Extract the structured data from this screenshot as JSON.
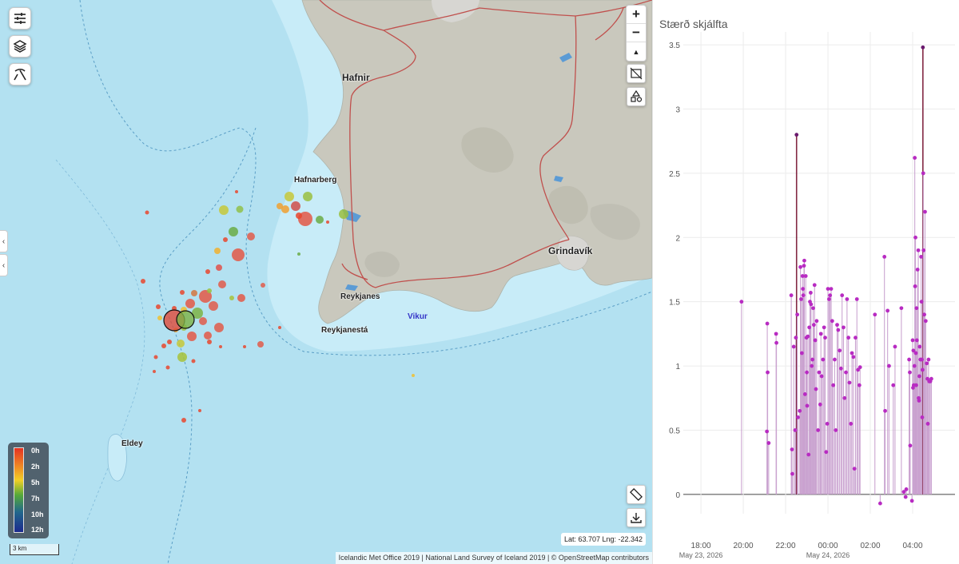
{
  "map": {
    "places": [
      {
        "name": "Hafnir",
        "kind": "big"
      },
      {
        "name": "Hafnarberg",
        "kind": "small"
      },
      {
        "name": "Grindavík",
        "kind": "big"
      },
      {
        "name": "Reykjanes",
        "kind": "small"
      },
      {
        "name": "Reykjanestá",
        "kind": "small"
      },
      {
        "name": "Vikur",
        "kind": "water"
      },
      {
        "name": "Eldey",
        "kind": "small"
      }
    ],
    "legend": {
      "labels": [
        "0h",
        "2h",
        "5h",
        "7h",
        "10h",
        "12h"
      ]
    },
    "scale_label": "3 km",
    "coords": "Lat: 63.707 Lng: -22.342",
    "attribution": "Icelandic Met Office 2019 | National Land Survey of Iceland 2019 | © OpenStreetMap contributors",
    "controls": {
      "zoom_in": "+",
      "zoom_out": "−",
      "reset_north": "▲",
      "left_buttons": [
        "sliders-icon",
        "layers-icon",
        "pickaxe-icon"
      ],
      "right_buttons": [
        "hide-labels-icon",
        "shapes-icon"
      ],
      "bottom_buttons": [
        "ruler-icon",
        "download-icon"
      ]
    },
    "colors": {
      "sea": "#b3e1f1",
      "shelf": "#c9ecf8",
      "land": "#c9c8bd",
      "road": "#c0504d",
      "lake": "#5b9bd5"
    }
  },
  "chart_data": {
    "type": "scatter",
    "title": "Stærð skjálfta",
    "xlabel": "",
    "ylabel": "",
    "ylim": [
      -0.15,
      3.6
    ],
    "yticks": [
      0,
      0.5,
      1,
      1.5,
      2,
      2.5,
      3,
      3.5
    ],
    "xlim": [
      "2026-05-23T17:10",
      "2026-05-24T06:00"
    ],
    "xticks": [
      {
        "t": "2026-05-23T18:00",
        "label": "18:00",
        "sub": "May 23, 2026"
      },
      {
        "t": "2026-05-23T20:00",
        "label": "20:00",
        "sub": ""
      },
      {
        "t": "2026-05-23T22:00",
        "label": "22:00",
        "sub": ""
      },
      {
        "t": "2026-05-24T00:00",
        "label": "00:00",
        "sub": "May 24, 2026"
      },
      {
        "t": "2026-05-24T02:00",
        "label": "02:00",
        "sub": ""
      },
      {
        "t": "2026-05-24T04:00",
        "label": "04:00",
        "sub": ""
      }
    ],
    "colors": {
      "stem": "#c9a1cf",
      "point": "#b82bc2",
      "highlight": "#7d1e3a"
    },
    "series": [
      {
        "points": [
          {
            "t": "2026-05-23T19:55",
            "v": 1.5
          },
          {
            "t": "2026-05-23T21:07",
            "v": 0.49
          },
          {
            "t": "2026-05-23T21:08",
            "v": 1.33
          },
          {
            "t": "2026-05-23T21:09",
            "v": 0.95
          },
          {
            "t": "2026-05-23T21:12",
            "v": 0.4
          },
          {
            "t": "2026-05-23T21:33",
            "v": 1.25
          },
          {
            "t": "2026-05-23T21:34",
            "v": 1.18
          },
          {
            "t": "2026-05-23T22:16",
            "v": 1.55
          },
          {
            "t": "2026-05-23T22:18",
            "v": 0.35
          },
          {
            "t": "2026-05-23T22:19",
            "v": 0.16
          },
          {
            "t": "2026-05-23T22:23",
            "v": 1.15
          },
          {
            "t": "2026-05-23T22:27",
            "v": 0.5
          },
          {
            "t": "2026-05-23T22:29",
            "v": 1.22
          },
          {
            "t": "2026-05-23T22:31",
            "v": 2.8
          },
          {
            "t": "2026-05-23T22:33",
            "v": 1.4
          },
          {
            "t": "2026-05-23T22:35",
            "v": 0.6
          },
          {
            "t": "2026-05-23T22:40",
            "v": 0.65
          },
          {
            "t": "2026-05-23T22:42",
            "v": 1.77
          },
          {
            "t": "2026-05-23T22:44",
            "v": 1.52
          },
          {
            "t": "2026-05-23T22:46",
            "v": 1.1
          },
          {
            "t": "2026-05-23T22:48",
            "v": 1.7
          },
          {
            "t": "2026-05-23T22:49",
            "v": 1.6
          },
          {
            "t": "2026-05-23T22:50",
            "v": 1.55
          },
          {
            "t": "2026-05-23T22:52",
            "v": 1.78
          },
          {
            "t": "2026-05-23T22:53",
            "v": 1.82
          },
          {
            "t": "2026-05-23T22:55",
            "v": 0.78
          },
          {
            "t": "2026-05-23T22:57",
            "v": 1.7
          },
          {
            "t": "2026-05-23T22:59",
            "v": 1.22
          },
          {
            "t": "2026-05-23T23:00",
            "v": 0.95
          },
          {
            "t": "2026-05-23T23:01",
            "v": 0.69
          },
          {
            "t": "2026-05-23T23:03",
            "v": 1.23
          },
          {
            "t": "2026-05-23T23:05",
            "v": 0.31
          },
          {
            "t": "2026-05-23T23:07",
            "v": 1.3
          },
          {
            "t": "2026-05-23T23:09",
            "v": 1.5
          },
          {
            "t": "2026-05-23T23:11",
            "v": 1.57
          },
          {
            "t": "2026-05-23T23:12",
            "v": 1.48
          },
          {
            "t": "2026-05-23T23:14",
            "v": 1.0
          },
          {
            "t": "2026-05-23T23:16",
            "v": 1.05
          },
          {
            "t": "2026-05-23T23:18",
            "v": 1.45
          },
          {
            "t": "2026-05-23T23:20",
            "v": 1.32
          },
          {
            "t": "2026-05-23T23:22",
            "v": 1.63
          },
          {
            "t": "2026-05-23T23:24",
            "v": 1.2
          },
          {
            "t": "2026-05-23T23:26",
            "v": 0.82
          },
          {
            "t": "2026-05-23T23:28",
            "v": 1.35
          },
          {
            "t": "2026-05-23T23:32",
            "v": 0.5
          },
          {
            "t": "2026-05-23T23:35",
            "v": 0.95
          },
          {
            "t": "2026-05-23T23:38",
            "v": 0.7
          },
          {
            "t": "2026-05-23T23:40",
            "v": 1.25
          },
          {
            "t": "2026-05-23T23:42",
            "v": 0.92
          },
          {
            "t": "2026-05-23T23:46",
            "v": 1.05
          },
          {
            "t": "2026-05-23T23:49",
            "v": 1.3
          },
          {
            "t": "2026-05-23T23:52",
            "v": 1.22
          },
          {
            "t": "2026-05-23T23:55",
            "v": 0.33
          },
          {
            "t": "2026-05-23T23:58",
            "v": 0.55
          },
          {
            "t": "2026-05-24T00:00",
            "v": 1.6
          },
          {
            "t": "2026-05-24T00:03",
            "v": 1.52
          },
          {
            "t": "2026-05-24T00:06",
            "v": 1.55
          },
          {
            "t": "2026-05-24T00:09",
            "v": 1.6
          },
          {
            "t": "2026-05-24T00:12",
            "v": 1.35
          },
          {
            "t": "2026-05-24T00:15",
            "v": 0.85
          },
          {
            "t": "2026-05-24T00:19",
            "v": 1.05
          },
          {
            "t": "2026-05-24T00:22",
            "v": 0.5
          },
          {
            "t": "2026-05-24T00:26",
            "v": 1.32
          },
          {
            "t": "2026-05-24T00:29",
            "v": 1.28
          },
          {
            "t": "2026-05-24T00:33",
            "v": 1.12
          },
          {
            "t": "2026-05-24T00:37",
            "v": 0.98
          },
          {
            "t": "2026-05-24T00:40",
            "v": 1.55
          },
          {
            "t": "2026-05-24T00:44",
            "v": 1.3
          },
          {
            "t": "2026-05-24T00:47",
            "v": 0.75
          },
          {
            "t": "2026-05-24T00:51",
            "v": 0.95
          },
          {
            "t": "2026-05-24T00:54",
            "v": 1.52
          },
          {
            "t": "2026-05-24T00:58",
            "v": 1.22
          },
          {
            "t": "2026-05-24T01:01",
            "v": 0.87
          },
          {
            "t": "2026-05-24T01:05",
            "v": 0.55
          },
          {
            "t": "2026-05-24T01:08",
            "v": 1.1
          },
          {
            "t": "2026-05-24T01:12",
            "v": 1.07
          },
          {
            "t": "2026-05-24T01:15",
            "v": 0.2
          },
          {
            "t": "2026-05-24T01:18",
            "v": 1.22
          },
          {
            "t": "2026-05-24T01:22",
            "v": 1.52
          },
          {
            "t": "2026-05-24T01:25",
            "v": 0.97
          },
          {
            "t": "2026-05-24T01:29",
            "v": 0.85
          },
          {
            "t": "2026-05-24T01:31",
            "v": 0.99
          },
          {
            "t": "2026-05-24T02:13",
            "v": 1.4
          },
          {
            "t": "2026-05-24T02:28",
            "v": -0.07
          },
          {
            "t": "2026-05-24T02:40",
            "v": 1.85
          },
          {
            "t": "2026-05-24T02:42",
            "v": 0.65
          },
          {
            "t": "2026-05-24T02:49",
            "v": 1.43
          },
          {
            "t": "2026-05-24T02:53",
            "v": 1.0
          },
          {
            "t": "2026-05-24T03:05",
            "v": 0.85
          },
          {
            "t": "2026-05-24T03:10",
            "v": 1.15
          },
          {
            "t": "2026-05-24T03:28",
            "v": 1.45
          },
          {
            "t": "2026-05-24T03:35",
            "v": 0.02
          },
          {
            "t": "2026-05-24T03:40",
            "v": -0.02
          },
          {
            "t": "2026-05-24T03:42",
            "v": 0.04
          },
          {
            "t": "2026-05-24T03:50",
            "v": 1.05
          },
          {
            "t": "2026-05-24T03:52",
            "v": 0.95
          },
          {
            "t": "2026-05-24T03:53",
            "v": 0.38
          },
          {
            "t": "2026-05-24T03:58",
            "v": -0.05
          },
          {
            "t": "2026-05-24T04:00",
            "v": 1.2
          },
          {
            "t": "2026-05-24T04:01",
            "v": 0.83
          },
          {
            "t": "2026-05-24T04:02",
            "v": 1.12
          },
          {
            "t": "2026-05-24T04:03",
            "v": 0.85
          },
          {
            "t": "2026-05-24T04:05",
            "v": 1.0
          },
          {
            "t": "2026-05-24T04:06",
            "v": 2.62
          },
          {
            "t": "2026-05-24T04:07",
            "v": 1.62
          },
          {
            "t": "2026-05-24T04:08",
            "v": 2.0
          },
          {
            "t": "2026-05-24T04:09",
            "v": 1.1
          },
          {
            "t": "2026-05-24T04:10",
            "v": 0.85
          },
          {
            "t": "2026-05-24T04:11",
            "v": 1.45
          },
          {
            "t": "2026-05-24T04:12",
            "v": 1.2
          },
          {
            "t": "2026-05-24T04:14",
            "v": 1.75
          },
          {
            "t": "2026-05-24T04:16",
            "v": 1.9
          },
          {
            "t": "2026-05-24T04:17",
            "v": 0.75
          },
          {
            "t": "2026-05-24T04:18",
            "v": 0.73
          },
          {
            "t": "2026-05-24T04:19",
            "v": 0.92
          },
          {
            "t": "2026-05-24T04:20",
            "v": 1.15
          },
          {
            "t": "2026-05-24T04:22",
            "v": 1.05
          },
          {
            "t": "2026-05-24T04:24",
            "v": 1.85
          },
          {
            "t": "2026-05-24T04:25",
            "v": 1.5
          },
          {
            "t": "2026-05-24T04:26",
            "v": 1.05
          },
          {
            "t": "2026-05-24T04:27",
            "v": 0.6
          },
          {
            "t": "2026-05-24T04:28",
            "v": 0.97
          },
          {
            "t": "2026-05-24T04:29",
            "v": 3.48
          },
          {
            "t": "2026-05-24T04:30",
            "v": 2.5
          },
          {
            "t": "2026-05-24T04:31",
            "v": 1.9
          },
          {
            "t": "2026-05-24T04:33",
            "v": 1.4
          },
          {
            "t": "2026-05-24T04:35",
            "v": 2.2
          },
          {
            "t": "2026-05-24T04:37",
            "v": 1.35
          },
          {
            "t": "2026-05-24T04:40",
            "v": 1.02
          },
          {
            "t": "2026-05-24T04:42",
            "v": 0.9
          },
          {
            "t": "2026-05-24T04:43",
            "v": 0.55
          },
          {
            "t": "2026-05-24T04:45",
            "v": 1.05
          },
          {
            "t": "2026-05-24T04:47",
            "v": 0.88
          },
          {
            "t": "2026-05-24T04:50",
            "v": 0.88
          },
          {
            "t": "2026-05-24T04:53",
            "v": 0.9
          }
        ]
      }
    ]
  }
}
